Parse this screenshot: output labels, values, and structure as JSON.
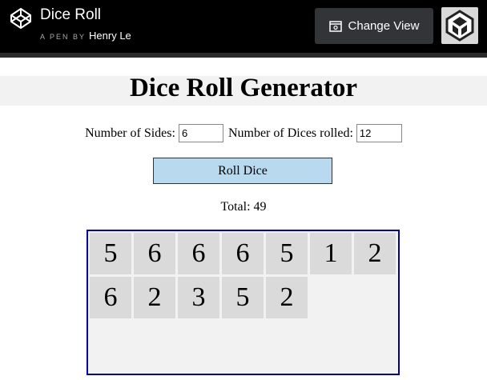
{
  "header": {
    "pen_title": "Dice Roll",
    "pen_by": "A PEN BY",
    "author": "Henry Le",
    "change_view_label": "Change View"
  },
  "app": {
    "title": "Dice Roll Generator",
    "sides_label": "Number of Sides:",
    "sides_value": "6",
    "count_label": "Number of Dices rolled:",
    "count_value": "12",
    "roll_button_label": "Roll Dice",
    "total_text": "Total: 49",
    "dice": [
      "5",
      "6",
      "6",
      "6",
      "5",
      "1",
      "2",
      "6",
      "2",
      "3",
      "5",
      "2"
    ]
  },
  "colors": {
    "header_bg": "#000000",
    "button_bg": "#b8d9ee",
    "dice_box_border": "#00009b",
    "die_bg": "#dadada"
  },
  "icons": {
    "logo": "codepen-logo-icon",
    "change_view": "window-icon",
    "avatar": "codepen-avatar-icon"
  }
}
